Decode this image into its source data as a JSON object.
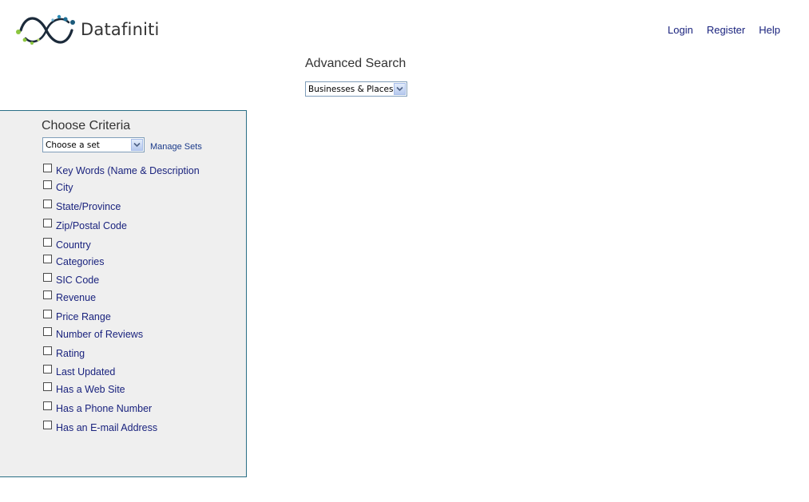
{
  "brand": {
    "name": "Datafiniti"
  },
  "nav": [
    {
      "key": "login",
      "label": "Login"
    },
    {
      "key": "register",
      "label": "Register"
    },
    {
      "key": "help",
      "label": "Help"
    }
  ],
  "search": {
    "title": "Advanced Search",
    "type_selected": "Businesses & Places"
  },
  "criteria_panel": {
    "title": "Choose Criteria",
    "set_select": "Choose a set",
    "manage_sets": "Manage Sets",
    "items": [
      {
        "label": "Key Words (Name & Description",
        "checked": false
      },
      {
        "label": "City",
        "checked": false
      },
      {
        "label": "State/Province",
        "checked": false
      },
      {
        "label": "Zip/Postal Code",
        "checked": false
      },
      {
        "label": "Country",
        "checked": false
      },
      {
        "label": "Categories",
        "checked": false
      },
      {
        "label": "SIC Code",
        "checked": false
      },
      {
        "label": "Revenue",
        "checked": false
      },
      {
        "label": "Price Range",
        "checked": false
      },
      {
        "label": "Number of Reviews",
        "checked": false
      },
      {
        "label": "Rating",
        "checked": false
      },
      {
        "label": "Last Updated",
        "checked": false
      },
      {
        "label": "Has a Web Site",
        "checked": false
      },
      {
        "label": "Has a Phone Number",
        "checked": false
      },
      {
        "label": "Has an E-mail Address",
        "checked": false
      }
    ]
  },
  "colors": {
    "link": "#1a237e",
    "panel_bg": "#efefef",
    "panel_border": "#2a6f86",
    "logo_dark": "#1b2a3a",
    "logo_green": "#8cc63f",
    "logo_blue": "#2b8bb4"
  }
}
